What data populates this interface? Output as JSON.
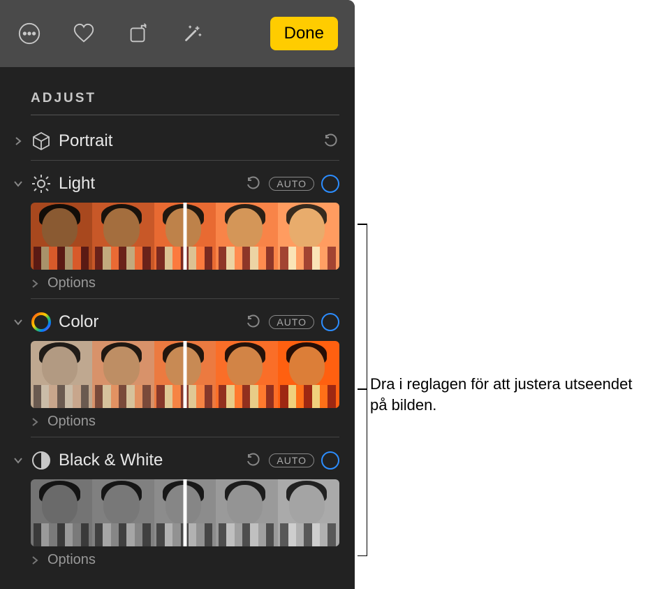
{
  "toolbar": {
    "more_icon": "more",
    "favorite_icon": "heart",
    "crop_icon": "crop",
    "magic_icon": "wand",
    "done_label": "Done"
  },
  "panel": {
    "title": "ADJUST"
  },
  "adjustments": {
    "portrait": {
      "label": "Portrait"
    },
    "light": {
      "label": "Light",
      "auto_label": "AUTO",
      "options_label": "Options"
    },
    "color": {
      "label": "Color",
      "auto_label": "AUTO",
      "options_label": "Options"
    },
    "bw": {
      "label": "Black & White",
      "auto_label": "AUTO",
      "options_label": "Options"
    }
  },
  "callout": {
    "text": "Dra i reglagen för att justera utseendet på bilden."
  }
}
